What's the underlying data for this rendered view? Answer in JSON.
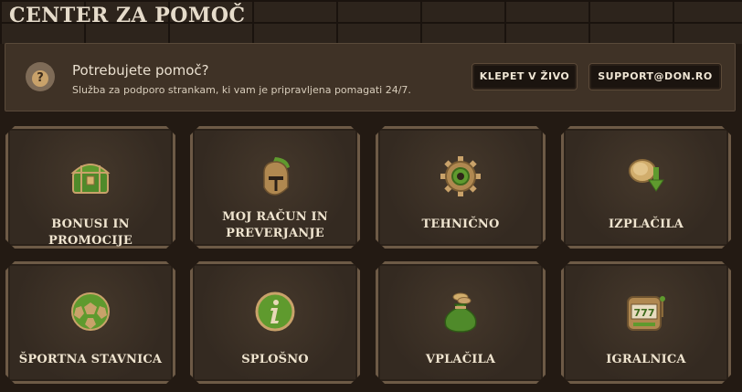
{
  "page": {
    "title": "Center za pomoč"
  },
  "banner": {
    "icon": "question-icon",
    "title": "Potrebujete pomoč?",
    "subtitle": "Služba za podporo strankam, ki vam je pripravljena pomagati 24/7.",
    "chat_button": "KLEPET V ŽIVO",
    "mail_button": "SUPPORT@DON.RO"
  },
  "categories": [
    {
      "label": "BONUSI IN PROMOCIJE",
      "icon": "treasure-chest-icon"
    },
    {
      "label": "MOJ RAČUN IN PREVERJANJE",
      "icon": "helmet-icon"
    },
    {
      "label": "TEHNIČNO",
      "icon": "gear-icon"
    },
    {
      "label": "IZPLAČILA",
      "icon": "coin-withdraw-icon"
    },
    {
      "label": "ŠPORTNA STAVNICA",
      "icon": "football-icon"
    },
    {
      "label": "SPLOŠNO",
      "icon": "info-icon"
    },
    {
      "label": "VPLAČILA",
      "icon": "money-bag-icon"
    },
    {
      "label": "IGRALNICA",
      "icon": "slot-machine-icon"
    }
  ],
  "colors": {
    "accent_green": "#5f9a2e",
    "gold": "#c9a26a",
    "background": "#231a13"
  }
}
